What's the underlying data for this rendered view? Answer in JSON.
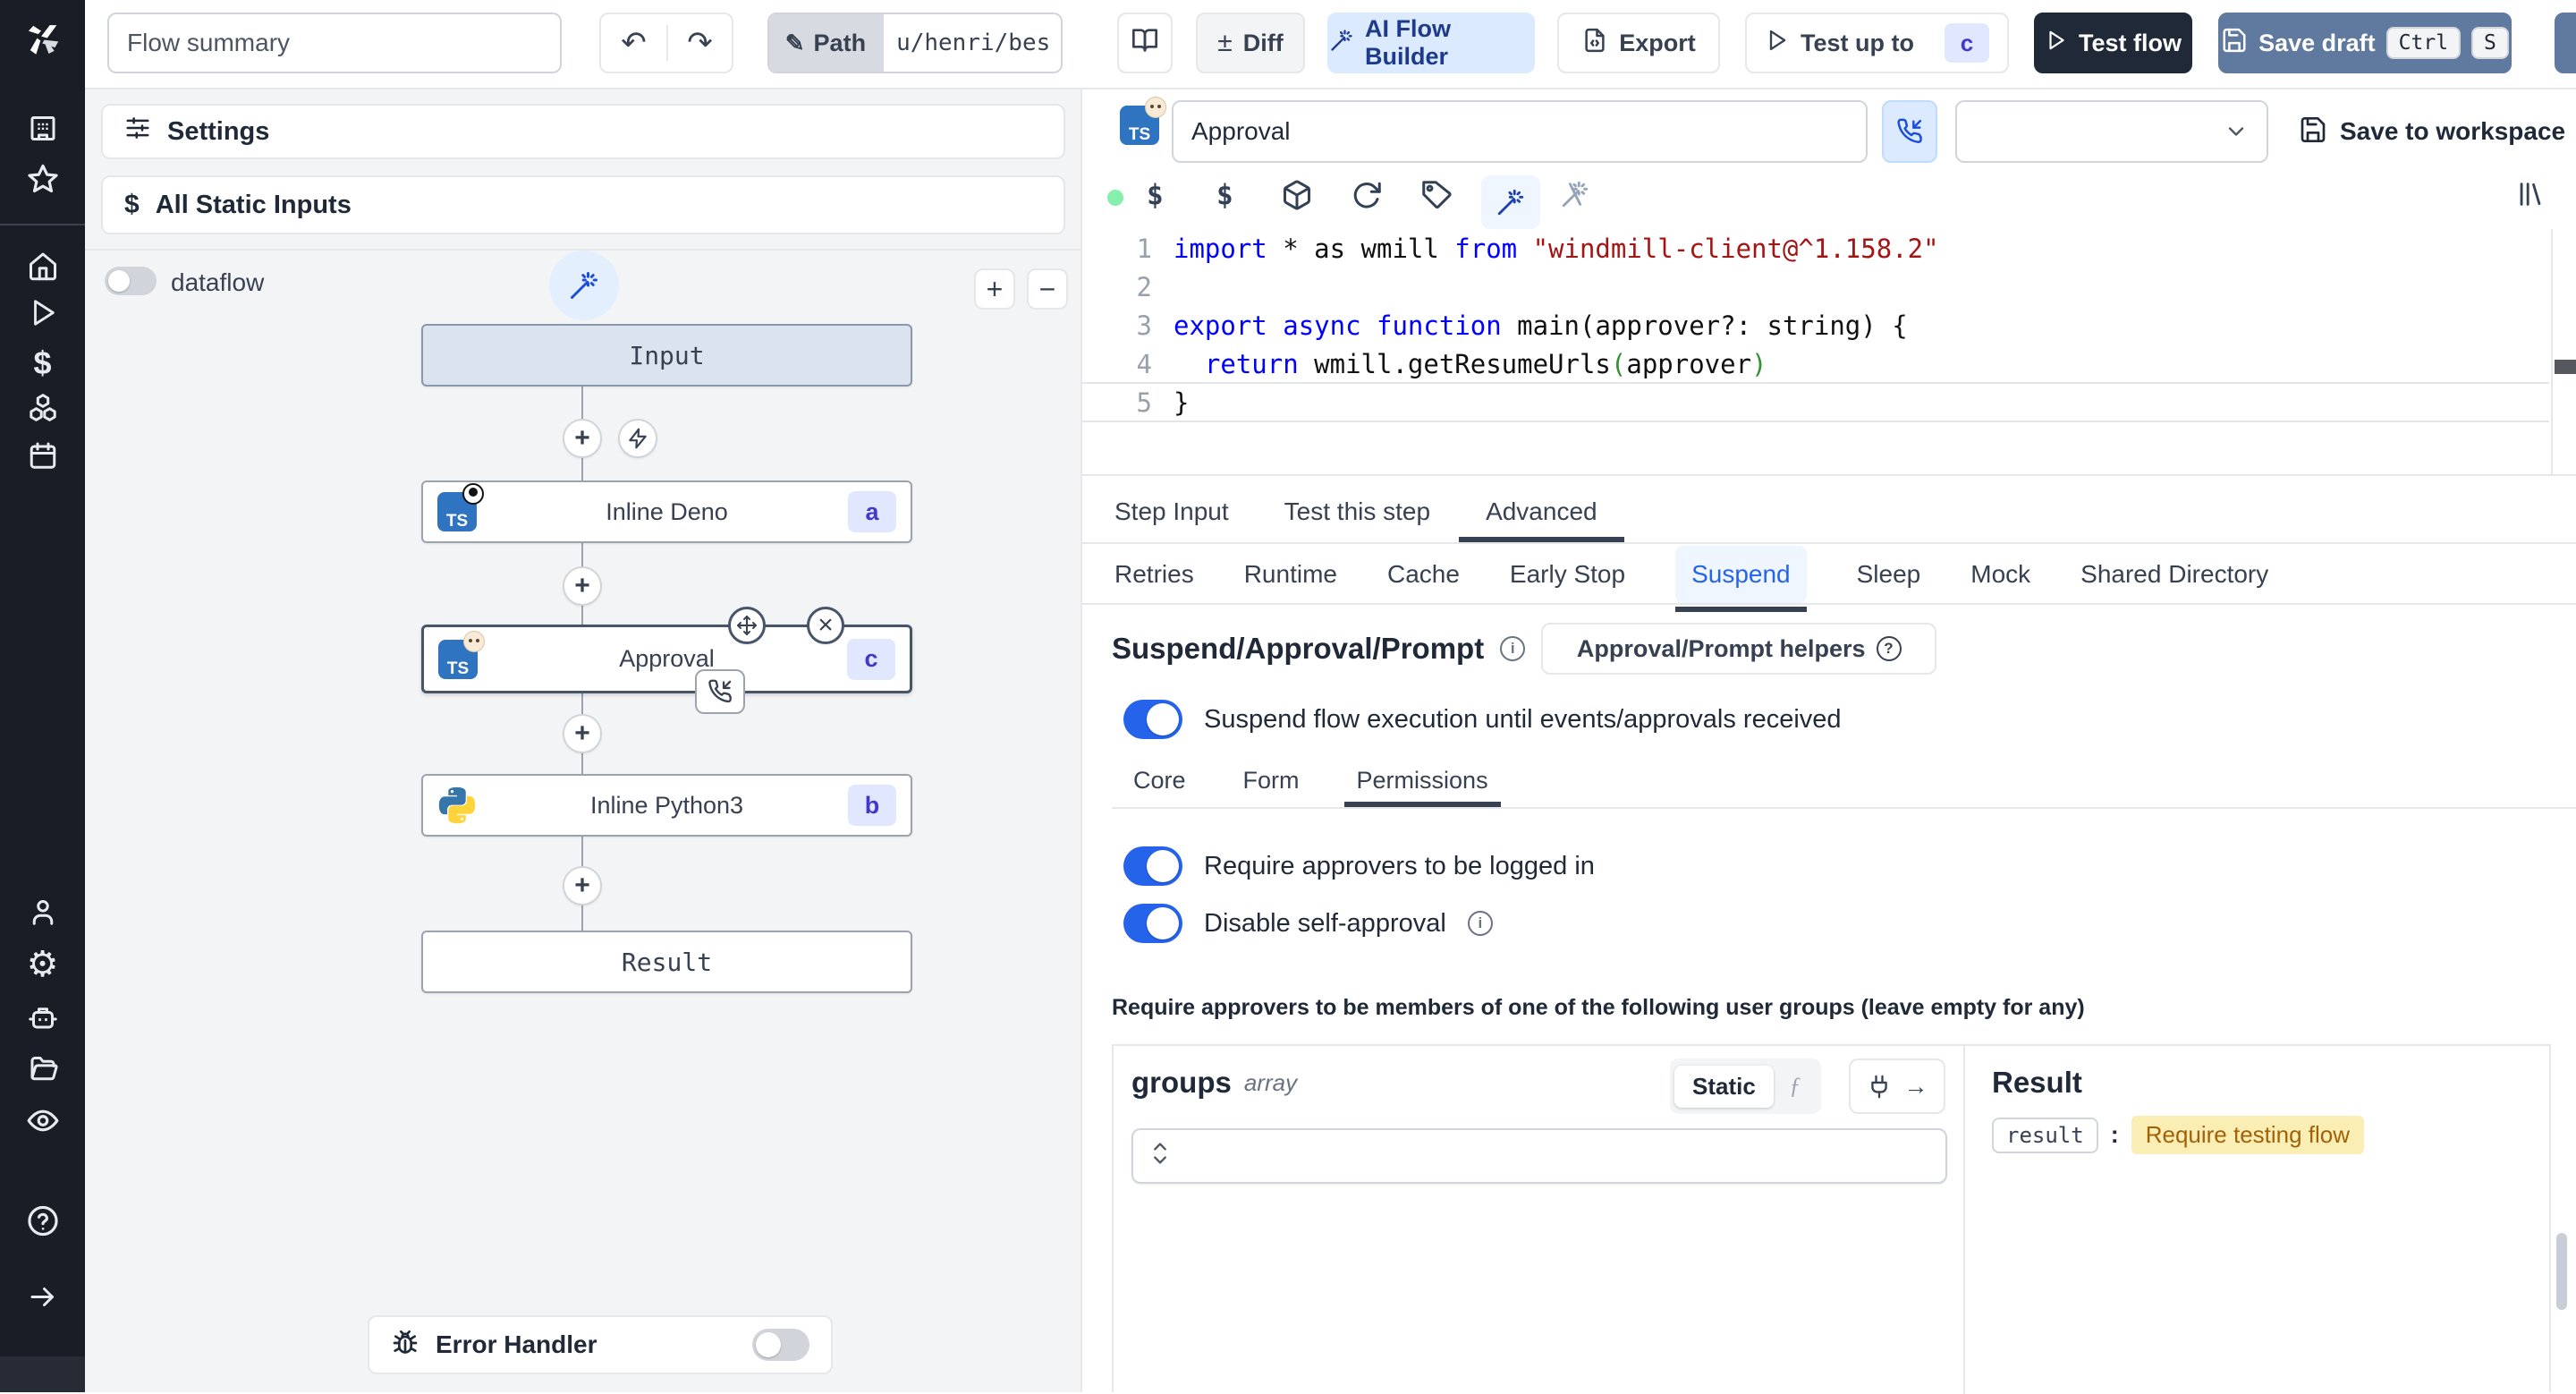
{
  "colors": {
    "accent_blue": "#2563eb",
    "ai_button_bg": "#dbeafe",
    "ai_button_text": "#1e3a8a",
    "dark_button_bg": "#1f2937",
    "save_draft_bg": "#60799f",
    "badge_bg": "#e0e7ff",
    "badge_text": "#4338ca",
    "input_node_bg": "#dbe3ee",
    "highlight_yellow_bg": "#fbeeb4",
    "highlight_yellow_text": "#a16207",
    "green_dot": "#86efac",
    "code_keyword": "#0000ff",
    "code_string": "#a31515",
    "code_bracket": "#319331",
    "sidebar_bg": "#191d26"
  },
  "icons": {
    "undo": "↶",
    "redo": "↷",
    "pencil": "✎",
    "plus_minus": "±",
    "plus": "+",
    "minus": "−",
    "close": "×",
    "dollar": "$",
    "fx": "ƒ",
    "info": "i",
    "question": "?",
    "colon": ":",
    "gear": "⚙"
  },
  "topbar": {
    "flow_summary_value": "Flow summary",
    "path_label": "Path",
    "path_value": "u/henri/bes",
    "diff_label": "Diff",
    "ai_flow_builder_label": "AI Flow Builder",
    "export_label": "Export",
    "test_up_to_label": "Test up to",
    "test_up_to_badge": "c",
    "test_flow_label": "Test flow",
    "save_draft_label": "Save draft",
    "kbd_ctrl": "Ctrl",
    "kbd_s": "S"
  },
  "flow_panel": {
    "settings_label": "Settings",
    "static_inputs_label": "All Static Inputs",
    "dataflow_label": "dataflow",
    "nodes": {
      "input_label": "Input",
      "deno_label": "Inline Deno",
      "deno_badge": "a",
      "approval_label": "Approval",
      "approval_badge": "c",
      "python_label": "Inline Python3",
      "python_badge": "b",
      "result_label": "Result"
    },
    "error_handler_label": "Error Handler"
  },
  "step_editor": {
    "name_value": "Approval",
    "save_to_workspace_label": "Save to workspace",
    "line_numbers": [
      "1",
      "2",
      "3",
      "4",
      "5"
    ],
    "code_lines": [
      [
        [
          "k",
          "import"
        ],
        [
          "d",
          " * as wmill "
        ],
        [
          "k",
          "from"
        ],
        [
          "d",
          " "
        ],
        [
          "s",
          "\"windmill-client@^1.158.2\""
        ]
      ],
      [],
      [
        [
          "k",
          "export"
        ],
        [
          "d",
          " "
        ],
        [
          "k",
          "async"
        ],
        [
          "d",
          " "
        ],
        [
          "k",
          "function"
        ],
        [
          "d",
          " main(approver?: string) {"
        ]
      ],
      [
        [
          "d",
          "  "
        ],
        [
          "k",
          "return"
        ],
        [
          "d",
          " wmill.getResumeUrls"
        ],
        [
          "g",
          "("
        ],
        [
          "d",
          "approver"
        ],
        [
          "g",
          ")"
        ]
      ],
      [
        [
          "d",
          "}"
        ]
      ]
    ]
  },
  "tabs": {
    "main": [
      {
        "label": "Step Input",
        "active": false
      },
      {
        "label": "Test this step",
        "active": false
      },
      {
        "label": "Advanced",
        "active": true
      }
    ],
    "advanced": [
      {
        "label": "Retries",
        "active": false
      },
      {
        "label": "Runtime",
        "active": false
      },
      {
        "label": "Cache",
        "active": false
      },
      {
        "label": "Early Stop",
        "active": false
      },
      {
        "label": "Suspend",
        "active": true
      },
      {
        "label": "Sleep",
        "active": false
      },
      {
        "label": "Mock",
        "active": false
      },
      {
        "label": "Shared Directory",
        "active": false
      }
    ]
  },
  "suspend_section": {
    "title": "Suspend/Approval/Prompt",
    "helpers_button_label": "Approval/Prompt helpers",
    "suspend_toggle_label": "Suspend flow execution until events/approvals received",
    "subtabs": [
      {
        "label": "Core",
        "active": false
      },
      {
        "label": "Form",
        "active": false
      },
      {
        "label": "Permissions",
        "active": true
      }
    ],
    "require_login_label": "Require approvers to be logged in",
    "disable_self_approval_label": "Disable self-approval",
    "groups_note": "Require approvers to be members of one of the following user groups (leave empty for any)"
  },
  "groups_editor": {
    "name": "groups",
    "type_label": "array",
    "static_label": "Static"
  },
  "result_panel": {
    "title": "Result",
    "key": "result",
    "value": "Require testing flow"
  }
}
